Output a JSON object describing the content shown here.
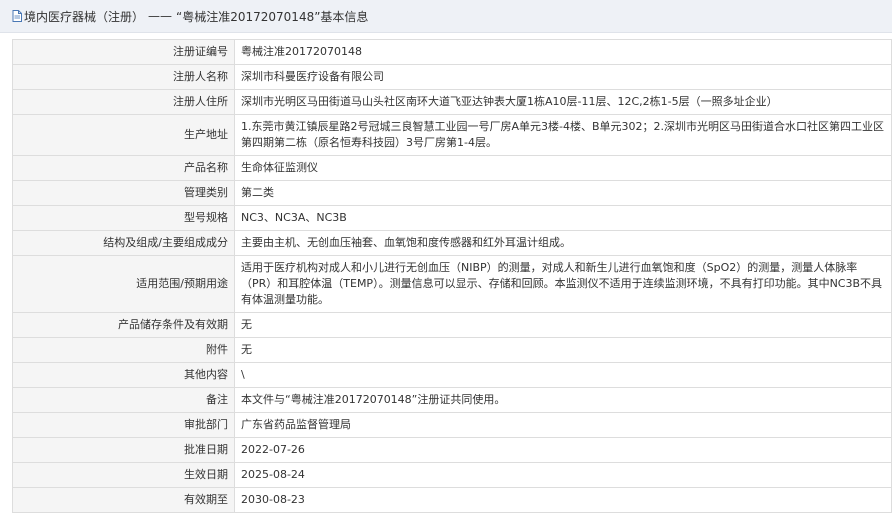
{
  "header": {
    "title": "境内医疗器械（注册）",
    "separator": "——",
    "subtitle": "“粤械注准20172070148”基本信息"
  },
  "rows": [
    {
      "label": "注册证编号",
      "value": "粤械注准20172070148"
    },
    {
      "label": "注册人名称",
      "value": "深圳市科曼医疗设备有限公司"
    },
    {
      "label": "注册人住所",
      "value": "深圳市光明区马田街道马山头社区南环大道飞亚达钟表大厦1栋A10层-11层、12C,2栋1-5层（一照多址企业）"
    },
    {
      "label": "生产地址",
      "value": "1.东莞市黄江镇辰星路2号冠城三良智慧工业园一号厂房A单元3楼-4楼、B单元302；2.深圳市光明区马田街道合水口社区第四工业区第四期第二栋（原名恒寿科技园）3号厂房第1-4层。"
    },
    {
      "label": "产品名称",
      "value": "生命体征监测仪"
    },
    {
      "label": "管理类别",
      "value": "第二类"
    },
    {
      "label": "型号规格",
      "value": "NC3、NC3A、NC3B"
    },
    {
      "label": "结构及组成/主要组成成分",
      "value": "主要由主机、无创血压袖套、血氧饱和度传感器和红外耳温计组成。"
    },
    {
      "label": "适用范围/预期用途",
      "value": "适用于医疗机构对成人和小儿进行无创血压（NIBP）的测量，对成人和新生儿进行血氧饱和度（SpO2）的测量，测量人体脉率（PR）和耳腔体温（TEMP）。测量信息可以显示、存储和回顾。本监测仪不适用于连续监测环境，不具有打印功能。其中NC3B不具有体温测量功能。"
    },
    {
      "label": "产品储存条件及有效期",
      "value": "无"
    },
    {
      "label": "附件",
      "value": "无"
    },
    {
      "label": "其他内容",
      "value": "\\"
    },
    {
      "label": "备注",
      "value": "本文件与“粤械注准20172070148”注册证共同使用。"
    },
    {
      "label": "审批部门",
      "value": "广东省药品监督管理局"
    },
    {
      "label": "批准日期",
      "value": "2022-07-26"
    },
    {
      "label": "生效日期",
      "value": "2025-08-24"
    },
    {
      "label": "有效期至",
      "value": "2030-08-23"
    }
  ]
}
